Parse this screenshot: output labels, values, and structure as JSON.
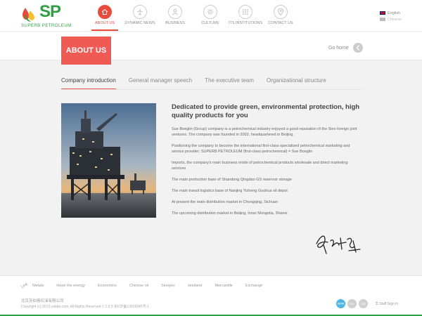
{
  "brand": {
    "logo_text": "SP",
    "name": "SUPERB PETROLEUM",
    "colors": {
      "green": "#2ea044",
      "red": "#e84a3c",
      "yellow": "#f2c029"
    }
  },
  "nav": {
    "items": [
      {
        "label": "ABOUT US",
        "icon": "home-icon",
        "active": true
      },
      {
        "label": "DYNAMIC NEWS",
        "icon": "plane-icon",
        "active": false
      },
      {
        "label": "BUSINESS",
        "icon": "person-icon",
        "active": false
      },
      {
        "label": "CULTURE",
        "icon": "sun-icon",
        "active": false
      },
      {
        "label": "ITS INSTITUTIONS",
        "icon": "grid-icon",
        "active": false
      },
      {
        "label": "CONTACT US",
        "icon": "location-pin-icon",
        "active": false
      }
    ]
  },
  "language": {
    "english": "English",
    "chinese": "Chinese"
  },
  "banner": {
    "section_title": "ABOUT US",
    "go_home": "Go home"
  },
  "tabs": [
    {
      "label": "Company introduction",
      "active": true
    },
    {
      "label": "General manager speech",
      "active": false
    },
    {
      "label": "The executive team",
      "active": false
    },
    {
      "label": "Organizational structure",
      "active": false
    }
  ],
  "article": {
    "heading": "Dedicated to provide green, environmental protection, high quality products for you",
    "paragraphs": [
      "Sue Boeglin (Group) company is a petrochemical industry enjoyed a good reputation of the Sino foreign joint ventures. The company was founded in 2002, headquartered in Beijing.",
      "Positioning the company to become the international first-class specialized petrochemical marketing and service provider; SUPERB PETROLEUM (first-class petrochemical) = Sue Boeglin",
      "Imports, the company's main business mode of petrochemical products wholesale and direct marketing services",
      "The main production base of Shandong Qingdao GS reservoir storage",
      "The main transit logistics base of Nanjing Yizheng Guohua oil depot",
      "At present the main distribution market in Chongqing, Sichuan",
      "The upcoming distribution market in Beijing, Inner Mongolia, Shanxi"
    ]
  },
  "footer": {
    "links_label": "Link",
    "links": [
      "Metals",
      "Hope the energy",
      "Economics",
      "Chinese oil",
      "Sinopec",
      "sinoland",
      "Mercantile",
      "Exchange"
    ],
    "company_cn": "北京苏伯格石油有限公司",
    "copyright": "Copyright (c) 2013 yabbe.com. All Rights Reserved V 1.0.5 京ICP备13019945号-1",
    "icon_labels": [
      "EPR",
      "OA",
      "QQ"
    ],
    "staff_sign_in": "Staff Sign in"
  }
}
